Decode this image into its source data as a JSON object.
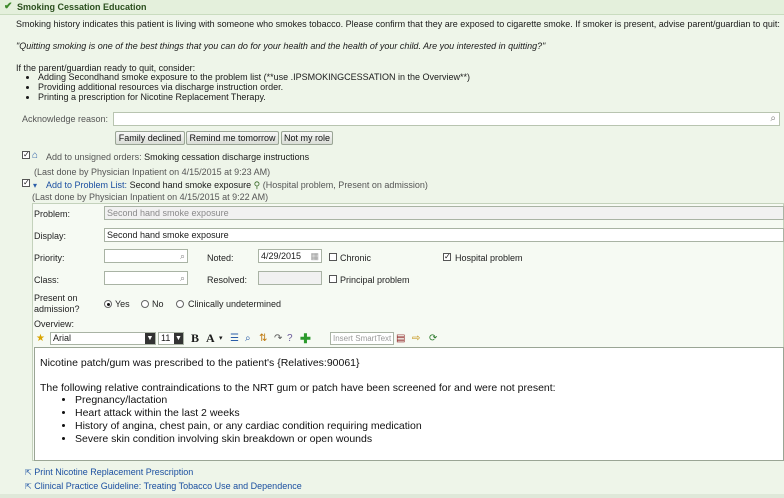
{
  "header": {
    "title": "Smoking Cessation Education"
  },
  "intro": "Smoking history indicates this patient is living with someone who smokes tobacco. Please confirm that they are exposed to cigarette smoke. If smoker is present, advise parent/guardian to quit:",
  "quote": "\"Quitting smoking is one of the best things that you can do for your health and the health of your child. Are you interested in quitting?\"",
  "consider_heading": "If the parent/guardian ready to quit, consider:",
  "consider_items": [
    "Adding Secondhand smoke exposure to the problem list (**use .IPSMOKINGCESSATION in the Overview**)",
    "Providing additional resources via discharge instruction order.",
    "Printing a prescription for Nicotine Replacement Therapy."
  ],
  "acknowledge": {
    "label": "Acknowledge reason:",
    "value": "",
    "buttons": [
      "Family declined",
      "Remind me tomorrow",
      "Not my role"
    ]
  },
  "order": {
    "prefix": "Add to unsigned orders:",
    "name": "Smoking cessation discharge instructions",
    "last_done": "(Last done by Physician Inpatient on 4/15/2015 at 9:23 AM)"
  },
  "problem_list": {
    "prefix": "Add to Problem List:",
    "name": "Second hand smoke exposure",
    "suffix": "(Hospital problem, Present on admission)",
    "last_done": "(Last done by Physician Inpatient on 4/15/2015 at 9:22 AM)"
  },
  "form": {
    "problem_label": "Problem:",
    "problem_value": "Second hand smoke exposure",
    "display_label": "Display:",
    "display_value": "Second hand smoke exposure",
    "priority_label": "Priority:",
    "noted_label": "Noted:",
    "noted_value": "4/29/2015",
    "chronic_label": "Chronic",
    "hospital_label": "Hospital problem",
    "class_label": "Class:",
    "resolved_label": "Resolved:",
    "principal_label": "Principal problem",
    "poa_label": "Present on admission?",
    "poa_options": [
      "Yes",
      "No",
      "Clinically undetermined"
    ],
    "overview_label": "Overview:"
  },
  "editor": {
    "font": "Arial",
    "size": "11",
    "smarttext_placeholder": "Insert SmartText",
    "line1": "Nicotine patch/gum was prescribed to the patient's {Relatives:90061}",
    "line2": "The following relative contraindications to the NRT gum or patch have been screened for and were not present:",
    "bullets": [
      "Pregnancy/lactation",
      "Heart attack within the last 2 weeks",
      "History of angina, chest pain, or any cardiac condition requiring medication",
      "Severe skin condition involving skin breakdown or open wounds"
    ]
  },
  "links": [
    "Print Nicotine Replacement Prescription",
    "Clinical Practice Guideline: Treating Tobacco Use and Dependence"
  ],
  "colors": {
    "header_bg": "#e4f0dc",
    "panel_bg": "#eef5e9",
    "link": "#1b4fa0",
    "check": "#3d8a2b"
  }
}
